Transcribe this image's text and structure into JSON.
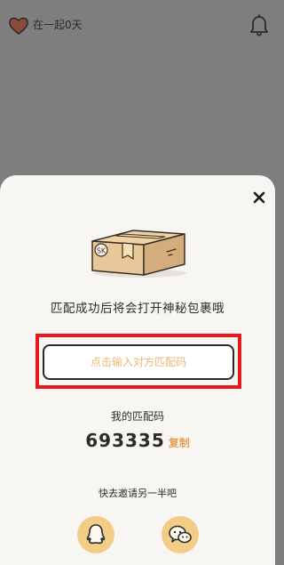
{
  "header": {
    "together_text": "在一起0天",
    "heart_icon": "heart-icon",
    "bell_icon": "bell-icon"
  },
  "dialog": {
    "close_icon": "close-icon",
    "illustration": {
      "box_label": "SK"
    },
    "hint": "匹配成功后将会打开神秘包裹哦",
    "input": {
      "value": "",
      "placeholder": "点击输入对方匹配码"
    },
    "my_code_label": "我的匹配码",
    "my_code": "693335",
    "copy_label": "复制",
    "invite_text": "快去邀请另一半吧",
    "share": {
      "qq_icon": "qq-icon",
      "wechat_icon": "wechat-icon"
    }
  },
  "colors": {
    "overlay": "#7e7e7e",
    "sheet": "#f8f6f3",
    "accent": "#e6a25a",
    "share_button": "#f3cc86",
    "heart": "#8b4a3c",
    "highlight": "#e6191c"
  }
}
